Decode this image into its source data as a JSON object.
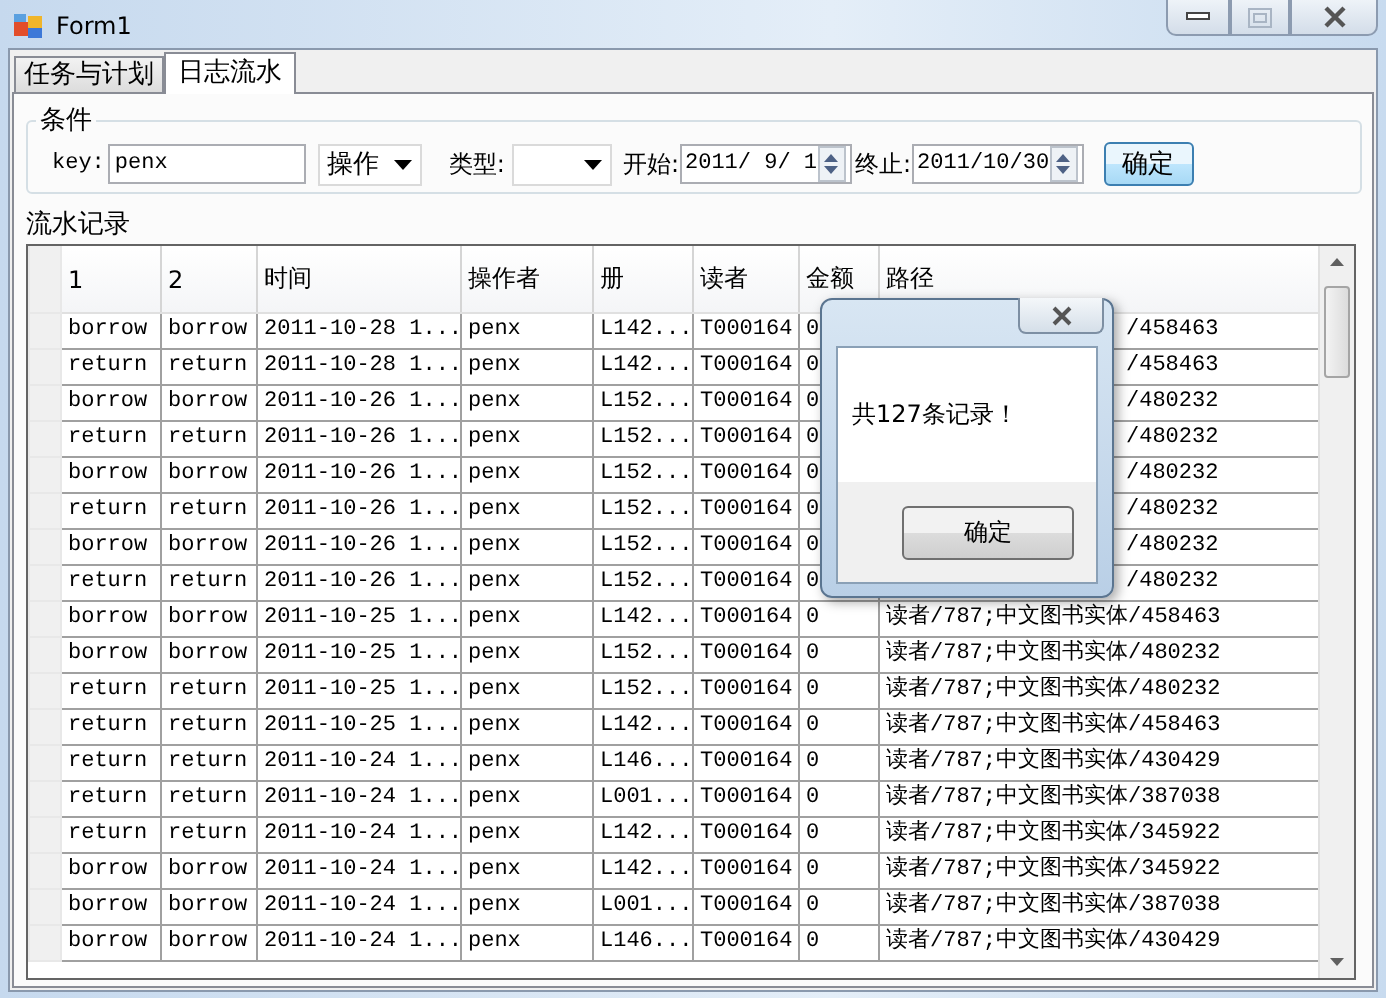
{
  "window": {
    "title": "Form1"
  },
  "tabs": [
    {
      "label": "任务与计划",
      "selected": false
    },
    {
      "label": "日志流水",
      "selected": true
    }
  ],
  "conditions": {
    "title": "条件",
    "key_label": "key:",
    "key_value": "penx",
    "field_select": "操作",
    "type_label": "类型:",
    "start_label": "开始:",
    "start_date": "2011/ 9/ 1",
    "end_label": "终止:",
    "end_date": "2011/10/30",
    "confirm_button": "确定"
  },
  "records": {
    "title": "流水记录",
    "columns": [
      "1",
      "2",
      "时间",
      "操作者",
      "册",
      "读者",
      "金额",
      "路径"
    ],
    "rows": [
      {
        "covered": true,
        "cells": [
          "borrow",
          "borrow",
          "2011-10-28 1...",
          "penx",
          "L142...",
          "T000164",
          "0",
          "/458463"
        ]
      },
      {
        "covered": true,
        "cells": [
          "return",
          "return",
          "2011-10-28 1...",
          "penx",
          "L142...",
          "T000164",
          "0",
          "/458463"
        ]
      },
      {
        "covered": true,
        "cells": [
          "borrow",
          "borrow",
          "2011-10-26 1...",
          "penx",
          "L152...",
          "T000164",
          "0",
          "/480232"
        ]
      },
      {
        "covered": true,
        "cells": [
          "return",
          "return",
          "2011-10-26 1...",
          "penx",
          "L152...",
          "T000164",
          "0",
          "/480232"
        ]
      },
      {
        "covered": true,
        "cells": [
          "borrow",
          "borrow",
          "2011-10-26 1...",
          "penx",
          "L152...",
          "T000164",
          "0",
          "/480232"
        ]
      },
      {
        "covered": true,
        "cells": [
          "return",
          "return",
          "2011-10-26 1...",
          "penx",
          "L152...",
          "T000164",
          "0",
          "/480232"
        ]
      },
      {
        "covered": true,
        "cells": [
          "borrow",
          "borrow",
          "2011-10-26 1...",
          "penx",
          "L152...",
          "T000164",
          "0",
          "/480232"
        ]
      },
      {
        "covered": true,
        "cells": [
          "return",
          "return",
          "2011-10-26 1...",
          "penx",
          "L152...",
          "T000164",
          "0",
          "/480232"
        ]
      },
      {
        "covered": false,
        "cells": [
          "borrow",
          "borrow",
          "2011-10-25 1...",
          "penx",
          "L142...",
          "T000164",
          "0",
          "读者/787;中文图书实体/458463"
        ]
      },
      {
        "covered": false,
        "cells": [
          "borrow",
          "borrow",
          "2011-10-25 1...",
          "penx",
          "L152...",
          "T000164",
          "0",
          "读者/787;中文图书实体/480232"
        ]
      },
      {
        "covered": false,
        "cells": [
          "return",
          "return",
          "2011-10-25 1...",
          "penx",
          "L152...",
          "T000164",
          "0",
          "读者/787;中文图书实体/480232"
        ]
      },
      {
        "covered": false,
        "cells": [
          "return",
          "return",
          "2011-10-25 1...",
          "penx",
          "L142...",
          "T000164",
          "0",
          "读者/787;中文图书实体/458463"
        ]
      },
      {
        "covered": false,
        "cells": [
          "return",
          "return",
          "2011-10-24 1...",
          "penx",
          "L146...",
          "T000164",
          "0",
          "读者/787;中文图书实体/430429"
        ]
      },
      {
        "covered": false,
        "cells": [
          "return",
          "return",
          "2011-10-24 1...",
          "penx",
          "L001...",
          "T000164",
          "0",
          "读者/787;中文图书实体/387038"
        ]
      },
      {
        "covered": false,
        "cells": [
          "return",
          "return",
          "2011-10-24 1...",
          "penx",
          "L142...",
          "T000164",
          "0",
          "读者/787;中文图书实体/345922"
        ]
      },
      {
        "covered": false,
        "cells": [
          "borrow",
          "borrow",
          "2011-10-24 1...",
          "penx",
          "L142...",
          "T000164",
          "0",
          "读者/787;中文图书实体/345922"
        ]
      },
      {
        "covered": false,
        "cells": [
          "borrow",
          "borrow",
          "2011-10-24 1...",
          "penx",
          "L001...",
          "T000164",
          "0",
          "读者/787;中文图书实体/387038"
        ]
      },
      {
        "covered": false,
        "cells": [
          "borrow",
          "borrow",
          "2011-10-24 1...",
          "penx",
          "L146...",
          "T000164",
          "0",
          "读者/787;中文图书实体/430429"
        ]
      }
    ]
  },
  "dialog": {
    "message": "共127条记录！",
    "ok_button": "确定"
  }
}
